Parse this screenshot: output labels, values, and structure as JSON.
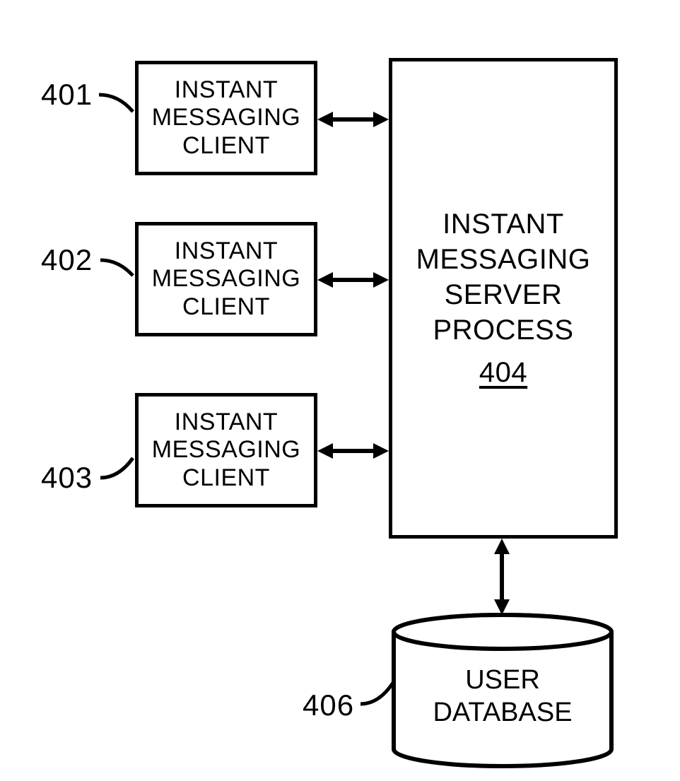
{
  "clients": [
    {
      "label_ref": "401",
      "lines": [
        "INSTANT",
        "MESSAGING",
        "CLIENT"
      ]
    },
    {
      "label_ref": "402",
      "lines": [
        "INSTANT",
        "MESSAGING",
        "CLIENT"
      ]
    },
    {
      "label_ref": "403",
      "lines": [
        "INSTANT",
        "MESSAGING",
        "CLIENT"
      ]
    }
  ],
  "server": {
    "lines": [
      "INSTANT",
      "MESSAGING",
      "SERVER",
      "PROCESS"
    ],
    "label_ref": "404"
  },
  "database": {
    "lines": [
      "USER",
      "DATABASE"
    ],
    "label_ref": "406"
  }
}
